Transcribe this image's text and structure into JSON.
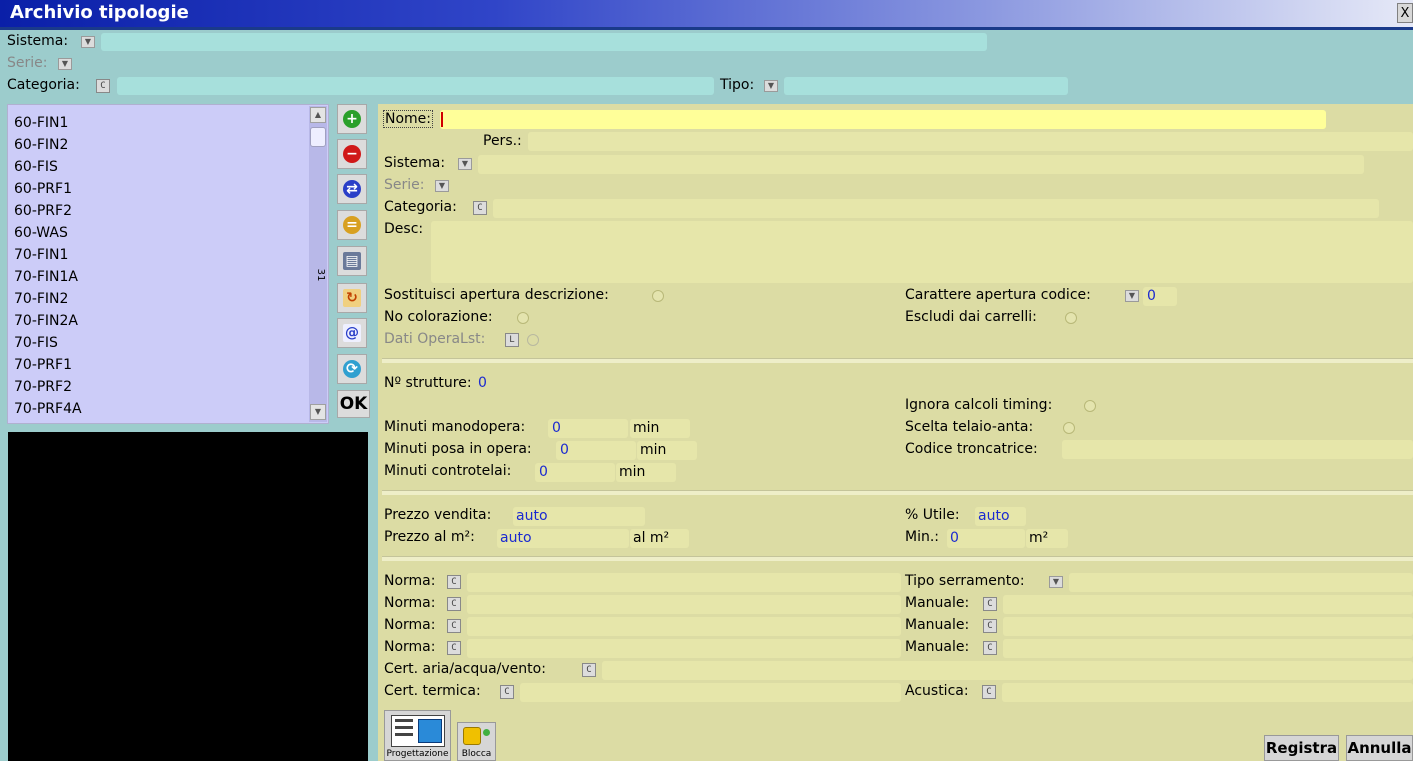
{
  "window": {
    "title": "Archivio tipologie",
    "close": "X"
  },
  "filters": {
    "sistema": "Sistema:",
    "serie": "Serie:",
    "categoria": "Categoria:",
    "categoria_btn": "C",
    "tipo": "Tipo:"
  },
  "list": {
    "items": [
      "60-FIN1",
      "60-FIN2",
      "60-FIS",
      "60-PRF1",
      "60-PRF2",
      "60-WAS",
      "70-FIN1",
      "70-FIN1A",
      "70-FIN2",
      "70-FIN2A",
      "70-FIS",
      "70-PRF1",
      "70-PRF2",
      "70-PRF4A"
    ],
    "count": "31"
  },
  "toolbar": {
    "ok": "OK"
  },
  "form": {
    "nome": "Nome:",
    "pers": "Pers.:",
    "sistema": "Sistema:",
    "serie": "Serie:",
    "categoria": "Categoria:",
    "desc": "Desc:",
    "sostituisci": "Sostituisci apertura descrizione:",
    "no_colorazione": "No colorazione:",
    "dati_operalst": "Dati OperaLst:",
    "carattere": "Carattere apertura codice:",
    "carattere_val": "0",
    "escludi": "Escludi dai carrelli:",
    "n_strutture": "Nº strutture:",
    "n_strutture_val": "0",
    "ignora": "Ignora calcoli timing:",
    "minuti_mano": "Minuti manodopera:",
    "minuti_mano_val": "0",
    "minuti_posa": "Minuti posa in opera:",
    "minuti_posa_val": "0",
    "minuti_contro": "Minuti controtelai:",
    "minuti_contro_val": "0",
    "unit_min": "min",
    "scelta": "Scelta telaio-anta:",
    "codice_tronc": "Codice troncatrice:",
    "prezzo_vendita": "Prezzo vendita:",
    "prezzo_vendita_val": "auto",
    "prezzo_m2": "Prezzo al m²:",
    "prezzo_m2_val": "auto",
    "unit_alm2": "al m²",
    "utile": "% Utile:",
    "utile_val": "auto",
    "min": "Min.:",
    "min_val": "0",
    "unit_m2": "m²",
    "norma": "Norma:",
    "tipo_serr": "Tipo serramento:",
    "manuale": "Manuale:",
    "cert_aria": "Cert. aria/acqua/vento:",
    "cert_termica": "Cert. termica:",
    "acustica": "Acustica:",
    "btn_c": "C",
    "btn_l": "L"
  },
  "bottom": {
    "progettazione": "Progettazione",
    "blocca": "Blocca",
    "registra": "Registra",
    "annulla": "Annulla"
  }
}
